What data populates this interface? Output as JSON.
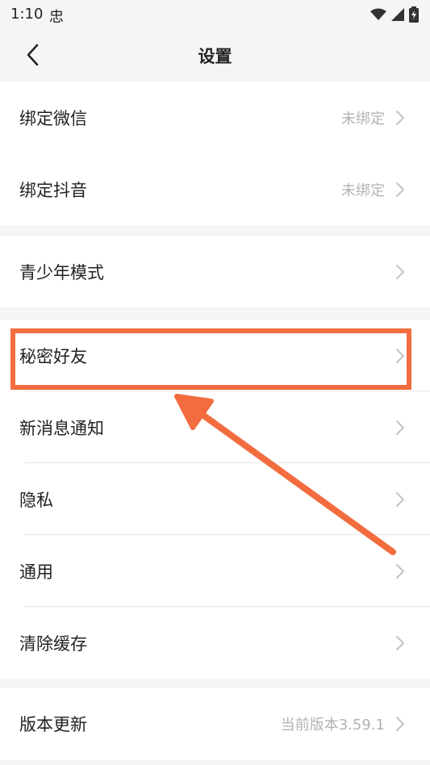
{
  "status_bar": {
    "time": "1:10",
    "app_icon": "忠"
  },
  "header": {
    "title": "设置"
  },
  "sections": [
    {
      "items": [
        {
          "label": "绑定微信",
          "value": "未绑定"
        },
        {
          "label": "绑定抖音",
          "value": "未绑定"
        }
      ]
    },
    {
      "items": [
        {
          "label": "青少年模式"
        }
      ]
    },
    {
      "items": [
        {
          "label": "秘密好友"
        },
        {
          "label": "新消息通知"
        },
        {
          "label": "隐私"
        },
        {
          "label": "通用"
        },
        {
          "label": "清除缓存"
        }
      ]
    },
    {
      "items": [
        {
          "label": "版本更新",
          "value": "当前版本3.59.1"
        }
      ]
    }
  ],
  "annotation": {
    "color": "#f26c3f",
    "highlighted_item": "秘密好友"
  }
}
